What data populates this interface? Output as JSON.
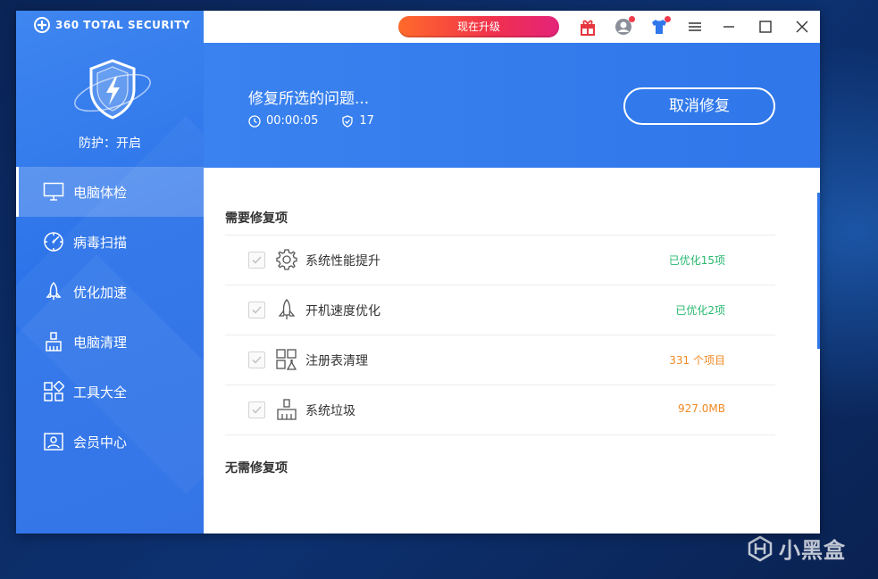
{
  "app": {
    "brand": "360 TOTAL SECURITY",
    "protection_status": "防护：开启"
  },
  "nav": {
    "items": [
      {
        "label": "电脑体检",
        "icon": "monitor-icon",
        "active": true
      },
      {
        "label": "病毒扫描",
        "icon": "radar-icon",
        "active": false
      },
      {
        "label": "优化加速",
        "icon": "rocket-icon",
        "active": false
      },
      {
        "label": "电脑清理",
        "icon": "broom-icon",
        "active": false
      },
      {
        "label": "工具大全",
        "icon": "tools-grid-icon",
        "active": false
      },
      {
        "label": "会员中心",
        "icon": "member-card-icon",
        "active": false
      }
    ]
  },
  "topbar": {
    "upgrade_label": "现在升级",
    "icons": [
      "gift-icon",
      "user-avatar-icon",
      "skin-shirt-icon",
      "menu-icon",
      "minimize-icon",
      "maximize-icon",
      "close-icon"
    ]
  },
  "banner": {
    "title": "修复所选的问题...",
    "elapsed": "00:00:05",
    "issue_count": "17",
    "cancel_label": "取消修复"
  },
  "sections": {
    "need_fix_title": "需要修复项",
    "no_fix_title": "无需修复项"
  },
  "items": [
    {
      "label": "系统性能提升",
      "value": "已优化15项",
      "icon": "gear-icon",
      "status_color": "#27b86e"
    },
    {
      "label": "开机速度优化",
      "value": "已优化2项",
      "icon": "rocket-icon",
      "status_color": "#27b86e"
    },
    {
      "label": "注册表清理",
      "value": "331 个项目",
      "icon": "registry-icon",
      "status_color": "#f08a24"
    },
    {
      "label": "系统垃圾",
      "value": "927.0MB",
      "icon": "broom-icon",
      "status_color": "#f08a24"
    }
  ],
  "watermark": {
    "text": "小黑盒"
  },
  "colors": {
    "accent": "#2f77ea",
    "upgrade_start": "#ff6a2a",
    "upgrade_end": "#e4237a"
  }
}
